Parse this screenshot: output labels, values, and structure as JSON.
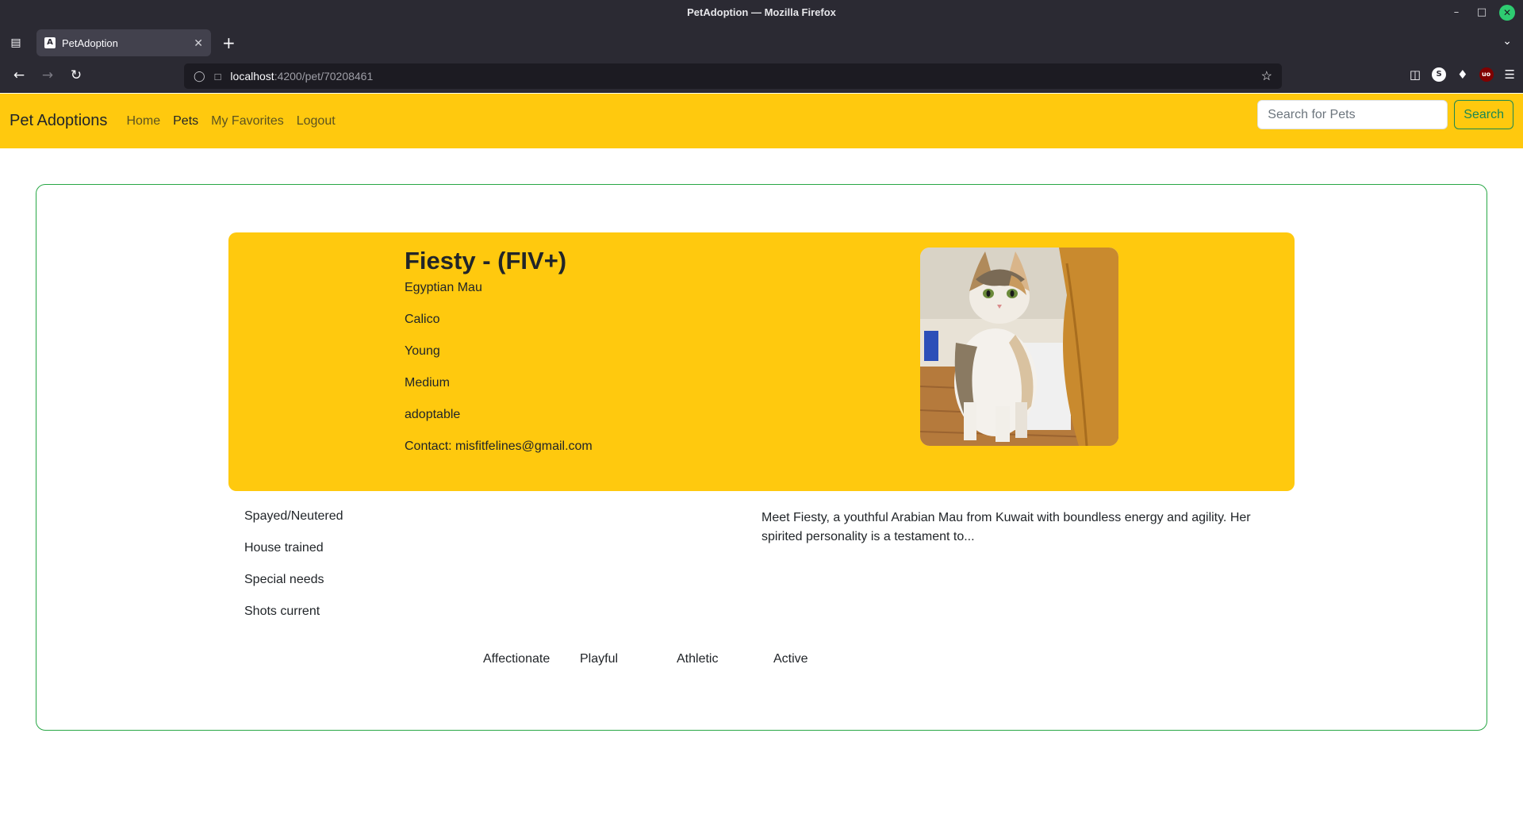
{
  "window": {
    "title": "PetAdoption — Mozilla Firefox"
  },
  "browser": {
    "tab_title": "PetAdoption",
    "tab_favicon_letter": "A",
    "url_host": "localhost",
    "url_path": ":4200/pet/70208461"
  },
  "app": {
    "brand": "Pet Adoptions",
    "nav": [
      {
        "label": "Home",
        "active": false
      },
      {
        "label": "Pets",
        "active": true
      },
      {
        "label": "My Favorites",
        "active": false
      },
      {
        "label": "Logout",
        "active": false
      }
    ],
    "search": {
      "placeholder": "Search for Pets",
      "value": "",
      "button_label": "Search"
    }
  },
  "pet": {
    "name": "Fiesty - (FIV+)",
    "breed": "Egyptian Mau",
    "color": "Calico",
    "age": "Young",
    "size": "Medium",
    "status": "adoptable",
    "contact": "Contact: misfitfelines@gmail.com",
    "attributes": [
      "Spayed/Neutered",
      "House trained",
      "Special needs",
      "Shots current"
    ],
    "description": "Meet Fiesty, a youthful Arabian Mau from Kuwait with boundless energy and agility. Her spirited personality is a testament to...",
    "tags": [
      "Affectionate",
      "Playful",
      "Athletic",
      "Active"
    ]
  },
  "colors": {
    "navbar": "#ffc90e",
    "hero": "#ffc90e",
    "card_border": "#28a745",
    "search_button": "#198754"
  }
}
